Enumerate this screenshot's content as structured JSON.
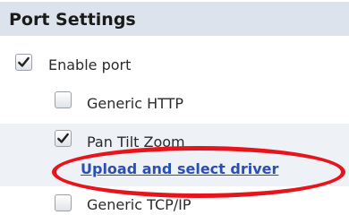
{
  "header": {
    "title": "Port Settings"
  },
  "options": {
    "enable_port": {
      "label": "Enable port",
      "checked": true
    },
    "generic_http": {
      "label": "Generic HTTP",
      "checked": false
    },
    "pan_tilt_zoom": {
      "label": "Pan Tilt Zoom",
      "checked": true,
      "link": "Upload and select driver"
    },
    "generic_tcp_ip": {
      "label": "Generic TCP/IP",
      "checked": false
    }
  },
  "colors": {
    "header_bg": "#dde3ec",
    "row_shade": "#eef1f6",
    "link": "#2a4fb0",
    "annotation": "#e8141c"
  },
  "icons": {
    "checked": "checkmark-icon"
  }
}
